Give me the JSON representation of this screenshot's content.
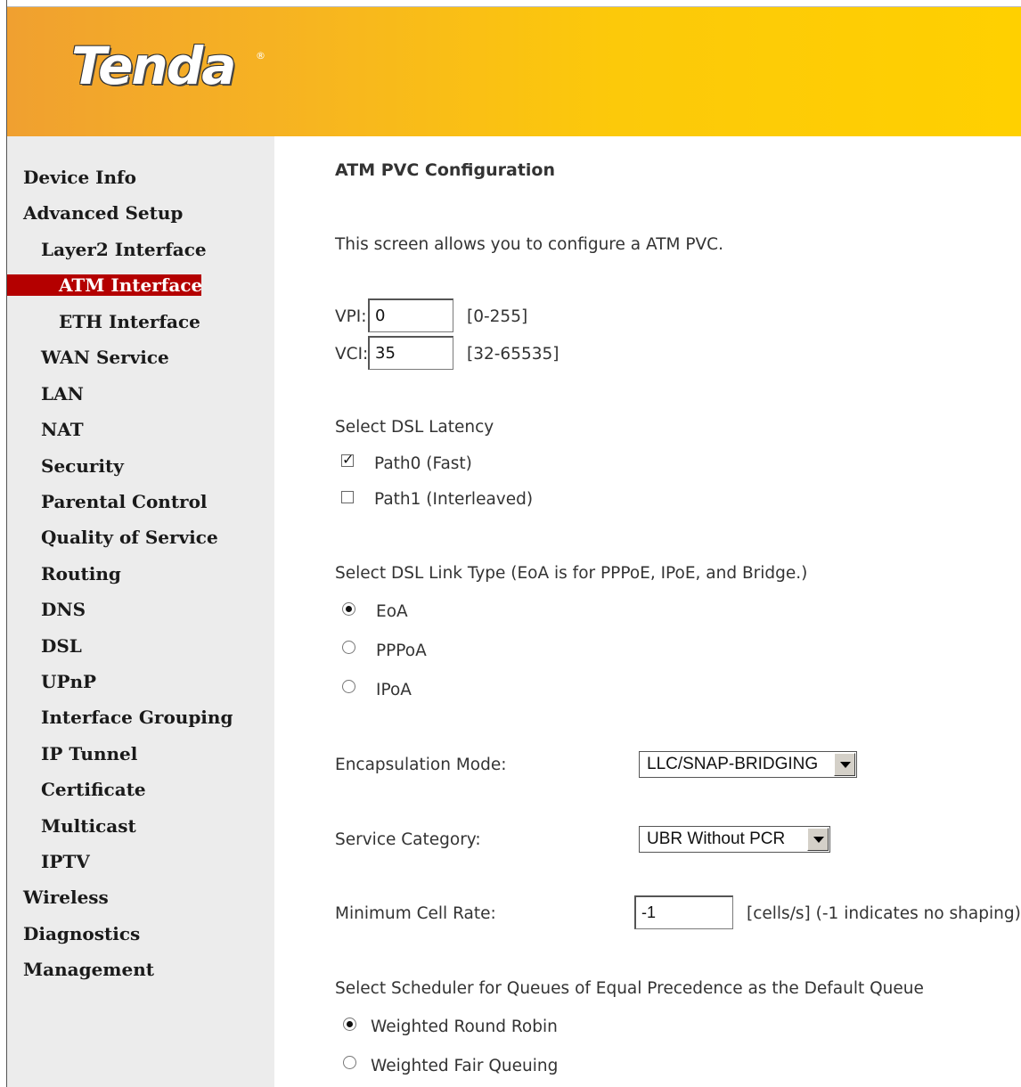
{
  "brand": {
    "logo_text": "Tenda",
    "logo_mark": "®"
  },
  "sidebar": {
    "items": [
      {
        "label": "Device Info"
      },
      {
        "label": "Advanced Setup"
      },
      {
        "label": "Layer2 Interface"
      },
      {
        "label": "ATM Interface"
      },
      {
        "label": "ETH Interface"
      },
      {
        "label": "WAN Service"
      },
      {
        "label": "LAN"
      },
      {
        "label": "NAT"
      },
      {
        "label": "Security"
      },
      {
        "label": "Parental Control"
      },
      {
        "label": "Quality of Service"
      },
      {
        "label": "Routing"
      },
      {
        "label": "DNS"
      },
      {
        "label": "DSL"
      },
      {
        "label": "UPnP"
      },
      {
        "label": "Interface Grouping"
      },
      {
        "label": "IP Tunnel"
      },
      {
        "label": "Certificate"
      },
      {
        "label": "Multicast"
      },
      {
        "label": "IPTV"
      },
      {
        "label": "Wireless"
      },
      {
        "label": "Diagnostics"
      },
      {
        "label": "Management"
      }
    ],
    "active": "ATM Interface"
  },
  "main": {
    "title": "ATM PVC Configuration",
    "intro": "This screen allows you to configure a ATM PVC.",
    "vpi": {
      "label": "VPI:",
      "value": "0",
      "range": "[0-255]"
    },
    "vci": {
      "label": "VCI:",
      "value": "35",
      "range": "[32-65535]"
    },
    "latency": {
      "heading": "Select DSL Latency",
      "options": [
        {
          "label": "Path0 (Fast)",
          "checked": true
        },
        {
          "label": "Path1 (Interleaved)",
          "checked": false
        }
      ]
    },
    "link_type": {
      "heading": "Select DSL Link Type (EoA is for PPPoE, IPoE, and Bridge.)",
      "options": [
        {
          "label": "EoA",
          "selected": true
        },
        {
          "label": "PPPoA",
          "selected": false
        },
        {
          "label": "IPoA",
          "selected": false
        }
      ]
    },
    "encapsulation": {
      "label": "Encapsulation Mode:",
      "value": "LLC/SNAP-BRIDGING"
    },
    "service_category": {
      "label": "Service Category:",
      "value": "UBR Without PCR"
    },
    "min_cell_rate": {
      "label": "Minimum Cell Rate:",
      "value": "-1",
      "hint": "[cells/s] (-1 indicates no shaping)"
    },
    "scheduler": {
      "heading": "Select Scheduler for Queues of Equal Precedence as the Default Queue",
      "options": [
        {
          "label": "Weighted Round Robin",
          "selected": true
        },
        {
          "label": "Weighted Fair Queuing",
          "selected": false
        }
      ]
    }
  },
  "colors": {
    "header_start": "#f0a030",
    "header_end": "#ffd000",
    "active_nav": "#b40000",
    "sidebar_bg": "#ececec"
  }
}
